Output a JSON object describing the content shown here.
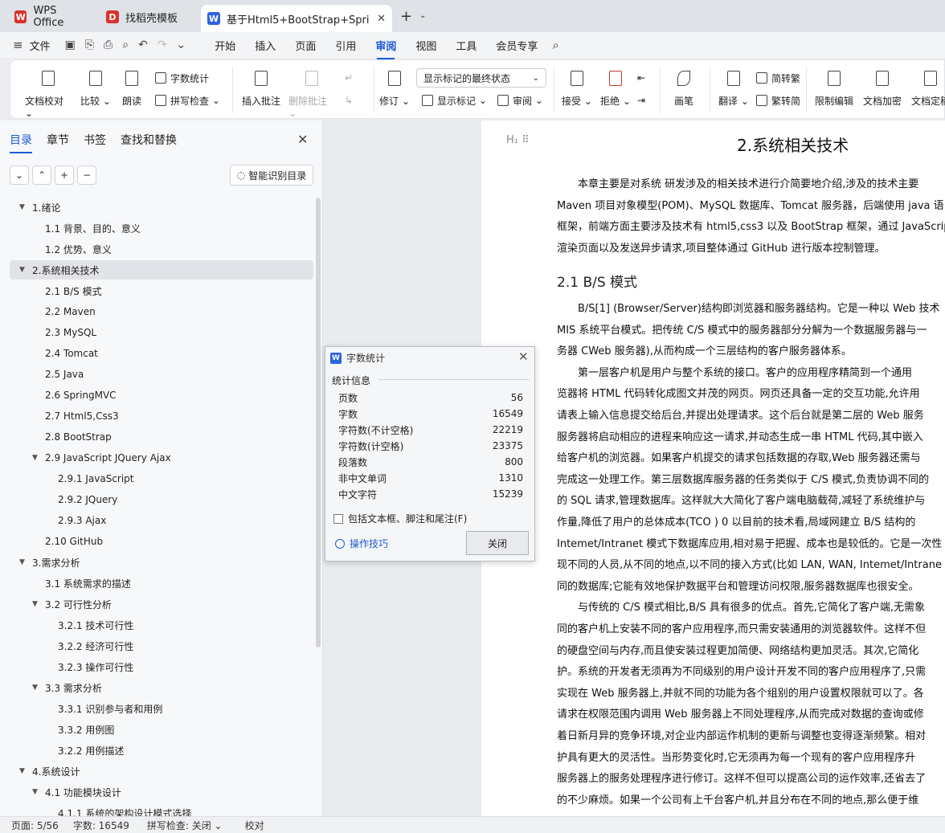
{
  "tabs": [
    {
      "label": "WPS Office",
      "logo": "W",
      "color": "#d9322b"
    },
    {
      "label": "找稻壳模板",
      "logo": "D",
      "color": "#d9322b"
    },
    {
      "label": "基于Html5+BootStrap+Spri",
      "logo": "W",
      "color": "#2b62e0"
    }
  ],
  "menu": {
    "file": "文件",
    "items": [
      "开始",
      "插入",
      "页面",
      "引用",
      "审阅",
      "视图",
      "工具",
      "会员专享"
    ],
    "active": "审阅"
  },
  "ribbon": {
    "doc_proof": "文档校对",
    "compare": "比较",
    "read_aloud": "朗读",
    "word_count": "字数统计",
    "spell_check": "拼写检查",
    "insert_comment": "插入批注",
    "delete_comment": "删除批注",
    "revise": "修订",
    "markup_state": "显示标记的最终状态",
    "show_markup": "显示标记",
    "review": "审阅",
    "accept": "接受",
    "reject": "拒绝",
    "pen": "画笔",
    "translate": "翻译",
    "to_traditional": "简转繁",
    "to_simplified": "繁转简",
    "restrict_edit": "限制编辑",
    "encrypt": "文档加密",
    "doc_final": "文档定稿"
  },
  "sidebar": {
    "tabs": [
      "目录",
      "章节",
      "书签",
      "查找和替换"
    ],
    "smart_toc": "智能识别目录",
    "toc": [
      {
        "label": "1.绪论",
        "level": 1,
        "arrow": true
      },
      {
        "label": "1.1  背景、目的、意义",
        "level": 2
      },
      {
        "label": "1.2  优势、意义",
        "level": 2
      },
      {
        "label": "2.系统相关技术",
        "level": 1,
        "arrow": true,
        "selected": true
      },
      {
        "label": "2.1 B/S 模式",
        "level": 2
      },
      {
        "label": "2.2 Maven",
        "level": 2
      },
      {
        "label": "2.3 MySQL",
        "level": 2
      },
      {
        "label": "2.4 Tomcat",
        "level": 2
      },
      {
        "label": "2.5 Java",
        "level": 2
      },
      {
        "label": "2.6 SpringMVC",
        "level": 2
      },
      {
        "label": "2.7 Html5,Css3",
        "level": 2
      },
      {
        "label": "2.8 BootStrap",
        "level": 2
      },
      {
        "label": "2.9 JavaScript   JQuery    Ajax",
        "level": 2,
        "arrow": true
      },
      {
        "label": "2.9.1 JavaScript",
        "level": 3
      },
      {
        "label": "2.9.2 JQuery",
        "level": 3
      },
      {
        "label": "2.9.3 Ajax",
        "level": 3
      },
      {
        "label": "2.10 GitHub",
        "level": 2
      },
      {
        "label": "3.需求分析",
        "level": 1,
        "arrow": true
      },
      {
        "label": "3.1  系统需求的描述",
        "level": 2
      },
      {
        "label": "3.2  可行性分析",
        "level": 2,
        "arrow": true
      },
      {
        "label": "3.2.1 技术可行性",
        "level": 3
      },
      {
        "label": "3.2.2 经济可行性",
        "level": 3
      },
      {
        "label": "3.2.3 操作可行性",
        "level": 3
      },
      {
        "label": "3.3  需求分析",
        "level": 2,
        "arrow": true
      },
      {
        "label": "3.3.1  识别参与者和用例",
        "level": 3
      },
      {
        "label": "3.3.2  用例图",
        "level": 3
      },
      {
        "label": "3.2.2 用例描述",
        "level": 3
      },
      {
        "label": "4.系统设计",
        "level": 1,
        "arrow": true
      },
      {
        "label": "4.1 功能模块设计",
        "level": 2,
        "arrow": true
      },
      {
        "label": "4.1.1 系统的架构设计模式选择",
        "level": 3
      }
    ]
  },
  "document": {
    "heading": "2.系统相关技术",
    "subheading": "2.1 B/S 模式",
    "para1": [
      "　　本章主要是对系统  研发涉及的相关技术进行介简要地介绍,涉及的技术主要",
      "Maven 项目对象模型(POM)、MySQL 数据库、Tomcat 服务器，后端使用 java 语",
      "框架，前端方面主要涉及技术有 html5,css3 以及 BootStrap 框架，通过 JavaScrip",
      "渲染页面以及发送异步请求,项目整体通过 GitHub 进行版本控制管理。"
    ],
    "para2": [
      "　　B/S[1] (Browser/Server)结构即浏览器和服务器结构。它是一种以 Web 技术",
      "MIS 系统平台模式。把传统 C/S 模式中的服务器部分分解为一个数据服务器与一",
      "务器 CWeb 服务器),从而构成一个三层结构的客户服务器体系。",
      "　　第一层客户机是用户与整个系统的接口。客户的应用程序精简到一个通用",
      "览器将 HTML 代码转化成图文并茂的网页。网页还具备一定的交互功能,允许用",
      "请表上输入信息提交给后台,并提出处理请求。这个后台就是第二层的 Web 服务",
      "服务器将启动相应的进程来响应这一请求,并动态生成一串 HTML 代码,其中嵌入",
      "给客户机的浏览器。如果客户机提交的请求包括数据的存取,Web 服务器还需与",
      "完成这一处理工作。第三层数据库服务器的任务类似于 C/S 模式,负责协调不同的",
      "的 SQL 请求,管理数据库。这样就大大简化了客户端电脑载荷,减轻了系统维护与",
      "作量,降低了用户的总体成本(TCO ) 0 以目前的技术看,局域网建立 B/S 结构的",
      "Intemet/Intranet 模式下数据库应用,相对易于把握、成本也是较低的。它是一次性",
      "现不同的人员,从不同的地点,以不同的接入方式(比如 LAN, WAN, Intemet/Intrane",
      "同的数据库;它能有效地保护数据平台和管理访问权限,服务器数据库也很安全。",
      "　　与传统的 C/S 模式相比,B/S 具有很多的优点。首先,它简化了客户端,无需象",
      "同的客户机上安装不同的客户应用程序,而只需安装通用的浏览器软件。这样不但",
      "的硬盘空间与内存,而且使安装过程更加简便、网络结构更加灵活。其次,它简化",
      "护。系统的开发者无须再为不同级别的用户设计开发不同的客户应用程序了,只需",
      "实现在 Web 服务器上,并就不同的功能为各个组别的用户设置权限就可以了。各",
      "请求在权限范围内调用 Web 服务器上不同处理程序,从而完成对数据的查询或修",
      "着日新月异的竞争环境,对企业内部运作机制的更新与调整也变得逐渐频繁。相对",
      "护具有更大的灵活性。当形势变化时,它无须再为每一个现有的客户应用程序升",
      "服务器上的服务处理程序进行修订。这样不但可以提高公司的运作效率,还省去了",
      "的不少麻烦。如果一个公司有上千台客户机,并且分布在不同的地点,那么便于维"
    ]
  },
  "dialog": {
    "title": "字数统计",
    "group": "统计信息",
    "stats": [
      {
        "label": "页数",
        "value": "56"
      },
      {
        "label": "字数",
        "value": "16549"
      },
      {
        "label": "字符数(不计空格)",
        "value": "22219"
      },
      {
        "label": "字符数(计空格)",
        "value": "23375"
      },
      {
        "label": "段落数",
        "value": "800"
      },
      {
        "label": "非中文单词",
        "value": "1310"
      },
      {
        "label": "中文字符",
        "value": "15239"
      }
    ],
    "checkbox": "包括文本框、脚注和尾注(F)",
    "tips": "操作技巧",
    "close": "关闭"
  },
  "status": {
    "page": "页面: 5/56",
    "words": "字数: 16549",
    "spell": "拼写检查: 关闭 ⌄",
    "proof": "校对"
  }
}
